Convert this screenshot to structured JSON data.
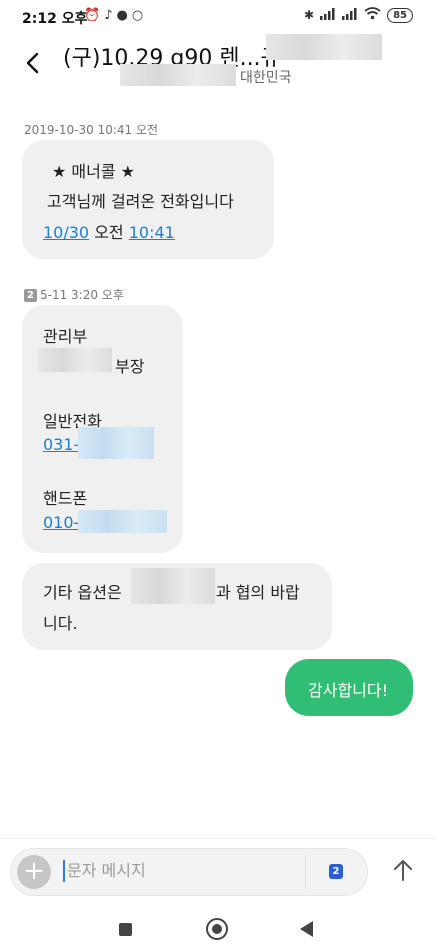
{
  "status_bar": {
    "time": "2:12 오후",
    "battery": "85",
    "left_icons": [
      "alarm-icon",
      "tiktok-icon",
      "chat-icon",
      "circle-icon"
    ],
    "right_icons": [
      "bluetooth-icon",
      "signal-icon",
      "signal-icon",
      "wifi-icon"
    ]
  },
  "header": {
    "title": "(구)10.29 g90 렌...규",
    "subtitle": "대한민국",
    "back_icon": "chevron-left-icon"
  },
  "messages": [
    {
      "timestamp": "2019-10-30 10:41 오전",
      "direction": "incoming",
      "lines": [
        "★ 매너콜 ★",
        "고객님께 걸려온 전화입니다"
      ],
      "date_link": "10/30",
      "ampm": "오전",
      "time_link": "10:41"
    },
    {
      "timestamp": "5-11 3:20 오후",
      "sim": "2",
      "direction": "incoming",
      "dept": "관리부",
      "position": "부장",
      "phone_label": "일반전화",
      "phone_prefix": "031-",
      "mobile_label": "핸드폰",
      "mobile_prefix": "010-"
    },
    {
      "direction": "incoming",
      "line1_prefix": "기타 옵션은",
      "line1_suffix": "과 협의 바랍",
      "line2": "니다."
    },
    {
      "direction": "outgoing",
      "text": "감사합니다!"
    }
  ],
  "composer": {
    "placeholder": "문자 메시지",
    "sim": "2",
    "plus_icon": "plus-icon",
    "send_icon": "arrow-up-icon"
  },
  "nav": {
    "icons": [
      "recent-apps-icon",
      "home-icon",
      "back-icon"
    ]
  },
  "colors": {
    "incoming_bubble": "#f0f0f0",
    "outgoing_bubble": "#2fbe74",
    "link": "#1f7fc5",
    "cursor": "#2c7be5",
    "sim_badge": "#2b5fd6"
  }
}
